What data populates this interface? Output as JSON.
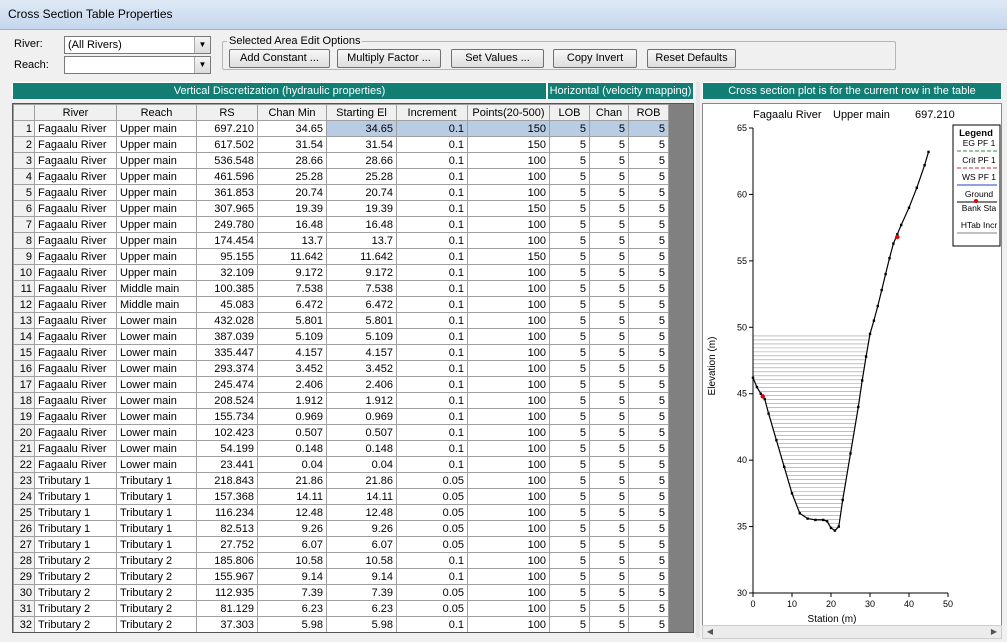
{
  "window": {
    "title": "Cross Section Table Properties"
  },
  "filters": {
    "river_label": "River:",
    "river_value": "(All Rivers)",
    "reach_label": "Reach:",
    "reach_value": ""
  },
  "edit_options": {
    "title": "Selected Area Edit Options",
    "buttons": [
      "Add Constant ...",
      "Multiply Factor ...",
      "Set Values ...",
      "Copy Invert",
      "Reset Defaults"
    ]
  },
  "headers": {
    "vertical": "Vertical Discretization (hydraulic properties)",
    "horizontal": "Horizontal (velocity mapping)",
    "plot": "Cross section plot is for the current row in the table"
  },
  "table": {
    "columns": [
      "River",
      "Reach",
      "RS",
      "Chan Min",
      "Starting El",
      "Increment",
      "Points(20-500)",
      "LOB",
      "Chan",
      "ROB"
    ],
    "rows": [
      [
        "1",
        "Fagaalu River",
        "Upper main",
        "697.210",
        "34.65",
        "34.65",
        "0.1",
        "150",
        "5",
        "5",
        "5"
      ],
      [
        "2",
        "Fagaalu River",
        "Upper main",
        "617.502",
        "31.54",
        "31.54",
        "0.1",
        "150",
        "5",
        "5",
        "5"
      ],
      [
        "3",
        "Fagaalu River",
        "Upper main",
        "536.548",
        "28.66",
        "28.66",
        "0.1",
        "100",
        "5",
        "5",
        "5"
      ],
      [
        "4",
        "Fagaalu River",
        "Upper main",
        "461.596",
        "25.28",
        "25.28",
        "0.1",
        "100",
        "5",
        "5",
        "5"
      ],
      [
        "5",
        "Fagaalu River",
        "Upper main",
        "361.853",
        "20.74",
        "20.74",
        "0.1",
        "100",
        "5",
        "5",
        "5"
      ],
      [
        "6",
        "Fagaalu River",
        "Upper main",
        "307.965",
        "19.39",
        "19.39",
        "0.1",
        "150",
        "5",
        "5",
        "5"
      ],
      [
        "7",
        "Fagaalu River",
        "Upper main",
        "249.780",
        "16.48",
        "16.48",
        "0.1",
        "100",
        "5",
        "5",
        "5"
      ],
      [
        "8",
        "Fagaalu River",
        "Upper main",
        "174.454",
        "13.7",
        "13.7",
        "0.1",
        "100",
        "5",
        "5",
        "5"
      ],
      [
        "9",
        "Fagaalu River",
        "Upper main",
        "95.155",
        "11.642",
        "11.642",
        "0.1",
        "150",
        "5",
        "5",
        "5"
      ],
      [
        "10",
        "Fagaalu River",
        "Upper main",
        "32.109",
        "9.172",
        "9.172",
        "0.1",
        "100",
        "5",
        "5",
        "5"
      ],
      [
        "11",
        "Fagaalu River",
        "Middle main",
        "100.385",
        "7.538",
        "7.538",
        "0.1",
        "100",
        "5",
        "5",
        "5"
      ],
      [
        "12",
        "Fagaalu River",
        "Middle main",
        "45.083",
        "6.472",
        "6.472",
        "0.1",
        "100",
        "5",
        "5",
        "5"
      ],
      [
        "13",
        "Fagaalu River",
        "Lower main",
        "432.028",
        "5.801",
        "5.801",
        "0.1",
        "100",
        "5",
        "5",
        "5"
      ],
      [
        "14",
        "Fagaalu River",
        "Lower main",
        "387.039",
        "5.109",
        "5.109",
        "0.1",
        "100",
        "5",
        "5",
        "5"
      ],
      [
        "15",
        "Fagaalu River",
        "Lower main",
        "335.447",
        "4.157",
        "4.157",
        "0.1",
        "100",
        "5",
        "5",
        "5"
      ],
      [
        "16",
        "Fagaalu River",
        "Lower main",
        "293.374",
        "3.452",
        "3.452",
        "0.1",
        "100",
        "5",
        "5",
        "5"
      ],
      [
        "17",
        "Fagaalu River",
        "Lower main",
        "245.474",
        "2.406",
        "2.406",
        "0.1",
        "100",
        "5",
        "5",
        "5"
      ],
      [
        "18",
        "Fagaalu River",
        "Lower main",
        "208.524",
        "1.912",
        "1.912",
        "0.1",
        "100",
        "5",
        "5",
        "5"
      ],
      [
        "19",
        "Fagaalu River",
        "Lower main",
        "155.734",
        "0.969",
        "0.969",
        "0.1",
        "100",
        "5",
        "5",
        "5"
      ],
      [
        "20",
        "Fagaalu River",
        "Lower main",
        "102.423",
        "0.507",
        "0.507",
        "0.1",
        "100",
        "5",
        "5",
        "5"
      ],
      [
        "21",
        "Fagaalu River",
        "Lower main",
        "54.199",
        "0.148",
        "0.148",
        "0.1",
        "100",
        "5",
        "5",
        "5"
      ],
      [
        "22",
        "Fagaalu River",
        "Lower main",
        "23.441",
        "0.04",
        "0.04",
        "0.1",
        "100",
        "5",
        "5",
        "5"
      ],
      [
        "23",
        "Tributary 1",
        "Tributary 1",
        "218.843",
        "21.86",
        "21.86",
        "0.05",
        "100",
        "5",
        "5",
        "5"
      ],
      [
        "24",
        "Tributary 1",
        "Tributary 1",
        "157.368",
        "14.11",
        "14.11",
        "0.05",
        "100",
        "5",
        "5",
        "5"
      ],
      [
        "25",
        "Tributary 1",
        "Tributary 1",
        "116.234",
        "12.48",
        "12.48",
        "0.05",
        "100",
        "5",
        "5",
        "5"
      ],
      [
        "26",
        "Tributary 1",
        "Tributary 1",
        "82.513",
        "9.26",
        "9.26",
        "0.05",
        "100",
        "5",
        "5",
        "5"
      ],
      [
        "27",
        "Tributary 1",
        "Tributary 1",
        "27.752",
        "6.07",
        "6.07",
        "0.05",
        "100",
        "5",
        "5",
        "5"
      ],
      [
        "28",
        "Tributary 2",
        "Tributary 2",
        "185.806",
        "10.58",
        "10.58",
        "0.1",
        "100",
        "5",
        "5",
        "5"
      ],
      [
        "29",
        "Tributary 2",
        "Tributary 2",
        "155.967",
        "9.14",
        "9.14",
        "0.1",
        "100",
        "5",
        "5",
        "5"
      ],
      [
        "30",
        "Tributary 2",
        "Tributary 2",
        "112.935",
        "7.39",
        "7.39",
        "0.05",
        "100",
        "5",
        "5",
        "5"
      ],
      [
        "31",
        "Tributary 2",
        "Tributary 2",
        "81.129",
        "6.23",
        "6.23",
        "0.05",
        "100",
        "5",
        "5",
        "5"
      ],
      [
        "32",
        "Tributary 2",
        "Tributary 2",
        "37.303",
        "5.98",
        "5.98",
        "0.1",
        "100",
        "5",
        "5",
        "5"
      ]
    ]
  },
  "plot": {
    "river": "Fagaalu River",
    "reach": "Upper main",
    "rs": "697.210",
    "legend_title": "Legend",
    "legend_items": [
      {
        "name": "EG PF 1",
        "color": "#3a8a3a",
        "style": "dash"
      },
      {
        "name": "Crit PF 1",
        "color": "#c03030",
        "style": "dash"
      },
      {
        "name": "WS PF 1",
        "color": "#2040c0",
        "style": "line"
      },
      {
        "name": "Ground",
        "color": "#000000",
        "style": "line"
      },
      {
        "name": "Bank Sta",
        "color": "#e00000",
        "style": "dot"
      },
      {
        "name": "HTab Incr",
        "color": "#808080",
        "style": "line"
      }
    ]
  },
  "chart_data": {
    "type": "line",
    "title": "",
    "xlabel": "Station (m)",
    "ylabel": "Elevation (m)",
    "xlim": [
      0,
      50
    ],
    "ylim": [
      30,
      65
    ],
    "xticks": [
      0,
      10,
      20,
      30,
      40,
      50
    ],
    "yticks": [
      30,
      35,
      40,
      45,
      50,
      55,
      60,
      65
    ],
    "series": [
      {
        "name": "Ground",
        "x": [
          0,
          1,
          2,
          3,
          4,
          6,
          8,
          10,
          12,
          14,
          16,
          18,
          19,
          20,
          21,
          22,
          23,
          25,
          27,
          28,
          29,
          30,
          31,
          32,
          33,
          34,
          35,
          36,
          37,
          38,
          40,
          42,
          44,
          45
        ],
        "y": [
          46.2,
          45.5,
          45.0,
          44.6,
          43.5,
          41.5,
          39.5,
          37.5,
          36.0,
          35.6,
          35.5,
          35.5,
          35.4,
          34.9,
          34.7,
          35.0,
          37.0,
          40.5,
          44.0,
          46.0,
          47.8,
          49.5,
          50.5,
          51.6,
          52.8,
          54.0,
          55.2,
          56.3,
          57.0,
          57.7,
          59.0,
          60.5,
          62.2,
          63.2
        ]
      }
    ],
    "bank_stations": [
      {
        "x": 2.5,
        "y": 44.8
      },
      {
        "x": 37.0,
        "y": 56.8
      }
    ],
    "htab": {
      "start": 34.65,
      "increment": 0.1,
      "top": 49.6
    }
  }
}
